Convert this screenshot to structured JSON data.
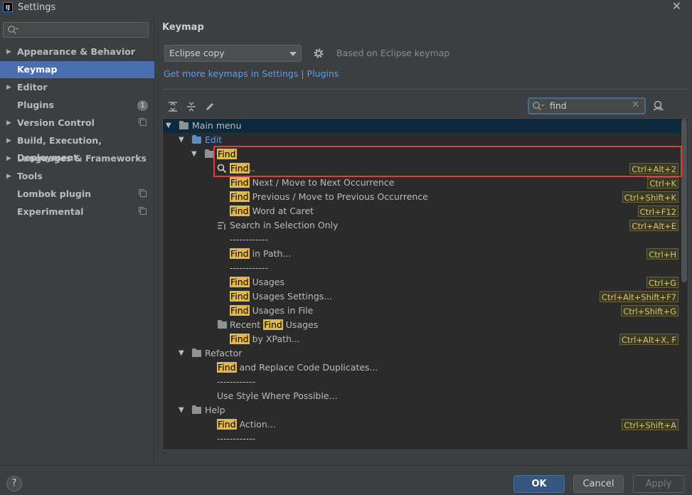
{
  "window": {
    "title": "Settings",
    "app_icon": "IJ"
  },
  "sidebar": {
    "search_placeholder": "",
    "items": [
      {
        "label": "Appearance & Behavior",
        "expandable": true
      },
      {
        "label": "Keymap",
        "selected": true
      },
      {
        "label": "Editor",
        "expandable": true
      },
      {
        "label": "Plugins",
        "badge": "1"
      },
      {
        "label": "Version Control",
        "expandable": true,
        "copy_icon": true
      },
      {
        "label": "Build, Execution, Deployment",
        "expandable": true
      },
      {
        "label": "Languages & Frameworks",
        "expandable": true
      },
      {
        "label": "Tools",
        "expandable": true
      },
      {
        "label": "Lombok plugin",
        "copy_icon": true
      },
      {
        "label": "Experimental",
        "copy_icon": true
      }
    ]
  },
  "main": {
    "title": "Keymap",
    "keymap_selected": "Eclipse copy",
    "based_on": "Based on Eclipse keymap",
    "link": "Get more keymaps in Settings | Plugins",
    "search_value": "find"
  },
  "tree": {
    "root": "Main menu",
    "edit": "Edit",
    "find_folder": "Find",
    "rows": {
      "find_dots": {
        "hl": "Find",
        "rest": "..",
        "shortcut": "Ctrl+Alt+2"
      },
      "find_next": {
        "hl": "Find",
        "rest": " Next / Move to Next Occurrence",
        "shortcut": "Ctrl+K"
      },
      "find_prev": {
        "hl": "Find",
        "rest": " Previous / Move to Previous Occurrence",
        "shortcut": "Ctrl+Shift+K"
      },
      "find_word": {
        "hl": "Find",
        "rest": " Word at Caret",
        "shortcut": "Ctrl+F12"
      },
      "search_sel": {
        "text": "Search in Selection Only",
        "shortcut": "Ctrl+Alt+E"
      },
      "sep1": "------------",
      "find_path": {
        "hl": "Find",
        "rest": " in Path...",
        "shortcut": "Ctrl+H"
      },
      "sep2": "------------",
      "find_usages": {
        "hl": "Find",
        "rest": " Usages",
        "shortcut": "Ctrl+G"
      },
      "find_usages_settings": {
        "hl": "Find",
        "rest": " Usages Settings...",
        "shortcut": "Ctrl+Alt+Shift+F7"
      },
      "find_usages_file": {
        "hl": "Find",
        "rest": " Usages in File",
        "shortcut": "Ctrl+Shift+G"
      },
      "recent": {
        "pre": "Recent ",
        "hl": "Find",
        "rest": " Usages"
      },
      "find_xpath": {
        "hl": "Find",
        "rest": " by XPath...",
        "shortcut": "Ctrl+Alt+X, F"
      },
      "refactor": "Refactor",
      "find_replace": {
        "hl": "Find",
        "rest": " and Replace Code Duplicates..."
      },
      "sep3": "------------",
      "use_style": "Use Style Where Possible...",
      "help": "Help",
      "find_action": {
        "hl": "Find",
        "rest": " Action...",
        "shortcut": "Ctrl+Shift+A"
      },
      "sep4": "------------"
    }
  },
  "footer": {
    "help": "?",
    "ok": "OK",
    "cancel": "Cancel",
    "apply": "Apply"
  },
  "colors": {
    "accent": "#4b6eaf",
    "highlight": "#e2b84a",
    "link": "#589df6",
    "annotation": "#e43a3a"
  }
}
